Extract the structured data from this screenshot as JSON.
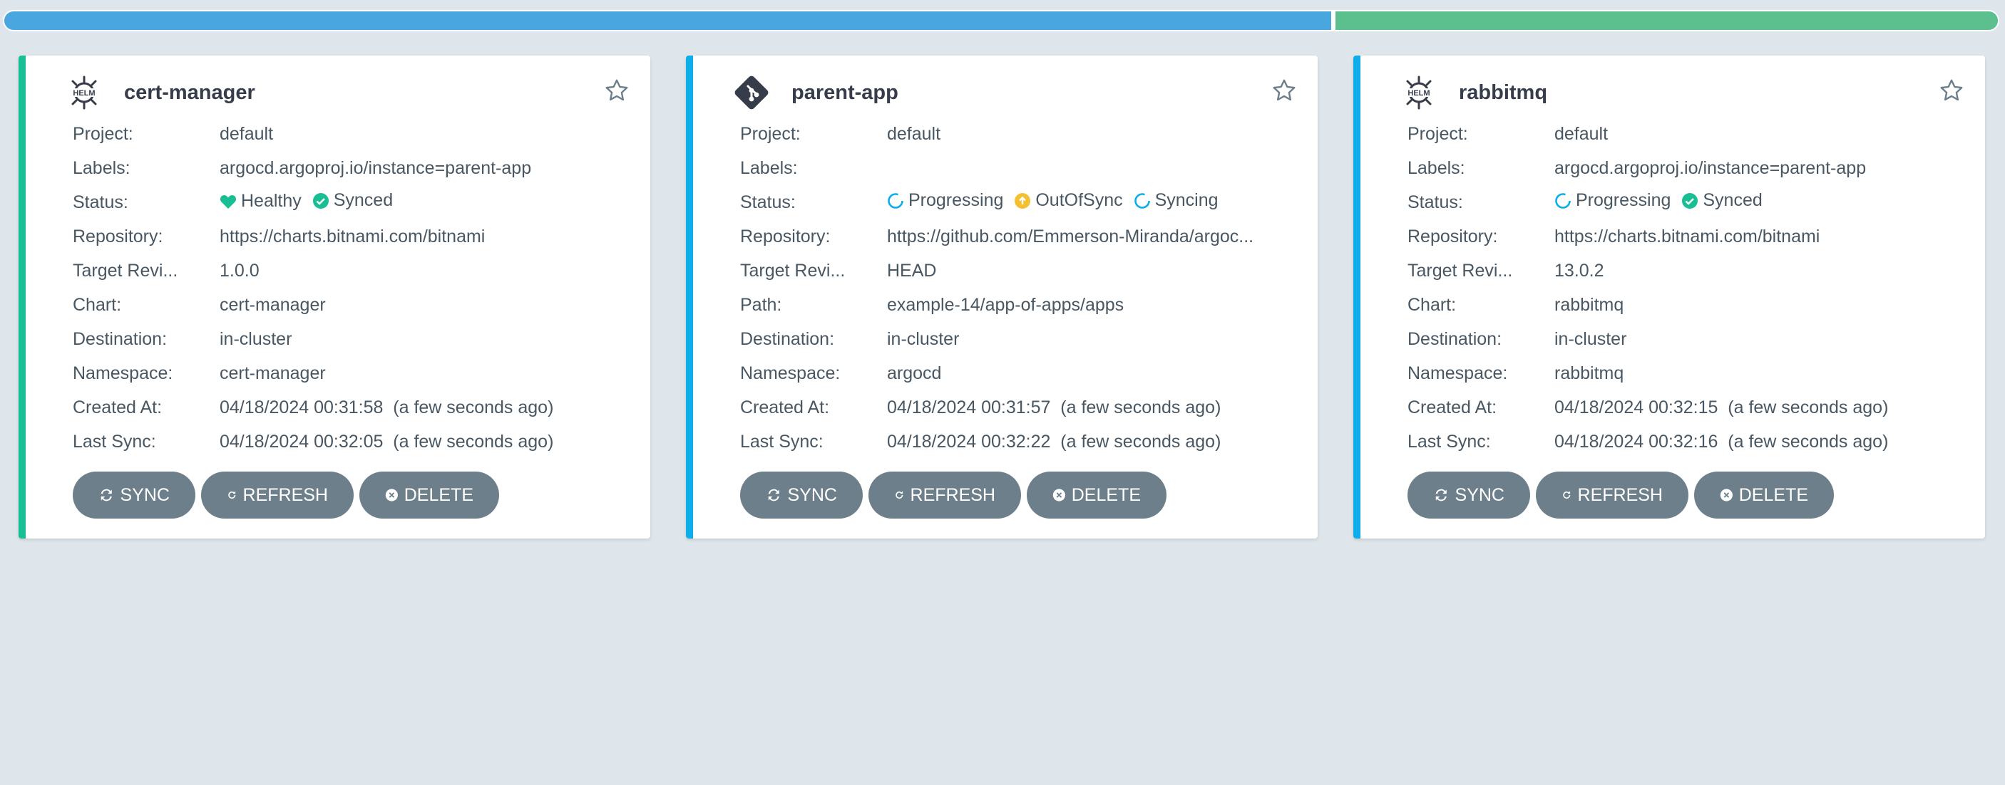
{
  "health_bar": [
    {
      "name": "progressing",
      "fraction": 0.667,
      "color": "#4aa6df"
    },
    {
      "name": "healthy",
      "fraction": 0.333,
      "color": "#5bbf8e"
    }
  ],
  "labels": {
    "project": "Project:",
    "labels": "Labels:",
    "status": "Status:",
    "repository": "Repository:",
    "target_revision": "Target Revi...",
    "chart": "Chart:",
    "path": "Path:",
    "destination": "Destination:",
    "namespace": "Namespace:",
    "created_at": "Created At:",
    "last_sync": "Last Sync:"
  },
  "buttons": {
    "sync": "SYNC",
    "refresh": "REFRESH",
    "delete": "DELETE"
  },
  "apps": [
    {
      "name": "cert-manager",
      "icon": "helm-icon",
      "border_color": "#18be94",
      "project": "default",
      "labels": "argocd.argoproj.io/instance=parent-app",
      "health": "Healthy",
      "sync": "Synced",
      "repository": "https://charts.bitnami.com/bitnami",
      "target_revision": "1.0.0",
      "chart": "cert-manager",
      "destination": "in-cluster",
      "namespace": "cert-manager",
      "created_at": "04/18/2024 00:31:58  (a few seconds ago)",
      "last_sync": "04/18/2024 00:32:05  (a few seconds ago)"
    },
    {
      "name": "parent-app",
      "icon": "git-icon",
      "border_color": "#0dadea",
      "project": "default",
      "labels": "",
      "health": "Progressing",
      "sync": "OutOfSync",
      "operation": "Syncing",
      "repository": "https://github.com/Emmerson-Miranda/argoc...",
      "target_revision": "HEAD",
      "path": "example-14/app-of-apps/apps",
      "destination": "in-cluster",
      "namespace": "argocd",
      "created_at": "04/18/2024 00:31:57  (a few seconds ago)",
      "last_sync": "04/18/2024 00:32:22  (a few seconds ago)"
    },
    {
      "name": "rabbitmq",
      "icon": "helm-icon",
      "border_color": "#0dadea",
      "project": "default",
      "labels": "argocd.argoproj.io/instance=parent-app",
      "health": "Progressing",
      "sync": "Synced",
      "repository": "https://charts.bitnami.com/bitnami",
      "target_revision": "13.0.2",
      "chart": "rabbitmq",
      "destination": "in-cluster",
      "namespace": "rabbitmq",
      "created_at": "04/18/2024 00:32:15  (a few seconds ago)",
      "last_sync": "04/18/2024 00:32:16  (a few seconds ago)"
    }
  ]
}
